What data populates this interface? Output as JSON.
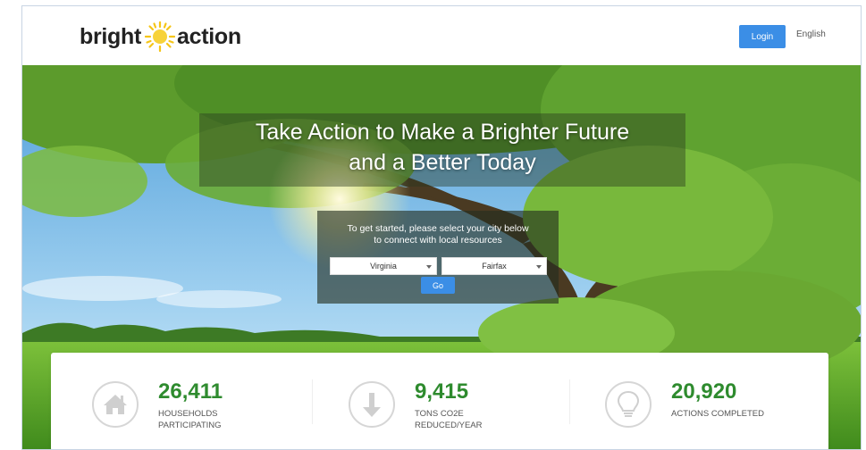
{
  "header": {
    "logo_left": "bright",
    "logo_right": "action",
    "login_label": "Login",
    "language_label": "English"
  },
  "hero": {
    "headline_line1": "Take Action to Make a Brighter Future",
    "headline_line2": "and a Better Today",
    "prompt_line1": "To get started, please select your city below",
    "prompt_line2": "to connect with local resources",
    "state_select": "Virginia",
    "city_select": "Fairfax",
    "go_label": "Go"
  },
  "stats": [
    {
      "icon": "home-icon",
      "value": "26,411",
      "label_line1": "HOUSEHOLDS",
      "label_line2": "PARTICIPATING"
    },
    {
      "icon": "arrow-down-icon",
      "value": "9,415",
      "label_line1": "TONS CO2E",
      "label_line2": "REDUCED/YEAR"
    },
    {
      "icon": "lightbulb-icon",
      "value": "20,920",
      "label_line1": "ACTIONS COMPLETED",
      "label_line2": ""
    }
  ],
  "colors": {
    "accent": "#3b8ee6",
    "stat_green": "#2e8b2e",
    "sun_yellow": "#f5c518"
  }
}
